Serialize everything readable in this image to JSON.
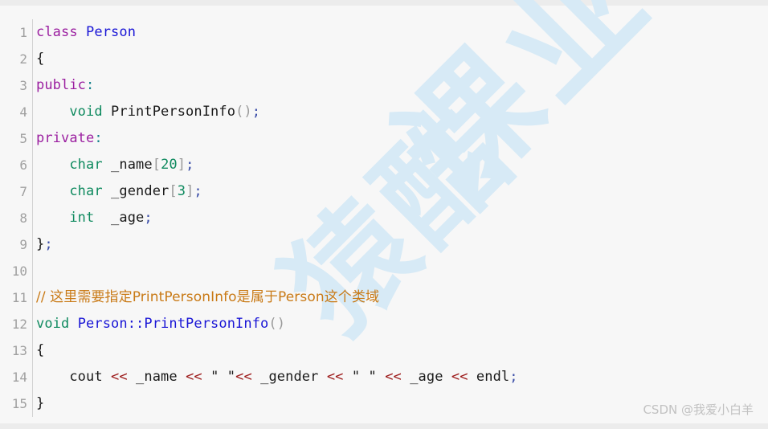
{
  "editor": {
    "language": "cpp",
    "background_color": "#f7f7f7",
    "gutter_color": "#a0a0a0",
    "divider_color": "#d2d2d2",
    "first_line": 1,
    "last_line": 15,
    "line_numbers": [
      "1",
      "2",
      "3",
      "4",
      "5",
      "6",
      "7",
      "8",
      "9",
      "10",
      "11",
      "12",
      "13",
      "14",
      "15"
    ],
    "lines": [
      {
        "number": "1",
        "tokens": [
          {
            "text": "class",
            "kind": "keyword"
          },
          {
            "text": " ",
            "kind": "plain"
          },
          {
            "text": "Person",
            "kind": "class"
          }
        ]
      },
      {
        "number": "2",
        "tokens": [
          {
            "text": "{",
            "kind": "plain"
          }
        ]
      },
      {
        "number": "3",
        "tokens": [
          {
            "text": "public",
            "kind": "keyword"
          },
          {
            "text": ":",
            "kind": "colon"
          }
        ]
      },
      {
        "number": "4",
        "tokens": [
          {
            "text": "    ",
            "kind": "plain"
          },
          {
            "text": "void",
            "kind": "type"
          },
          {
            "text": " ",
            "kind": "plain"
          },
          {
            "text": "PrintPersonInfo",
            "kind": "plain"
          },
          {
            "text": "(",
            "kind": "punct"
          },
          {
            "text": ")",
            "kind": "punct"
          },
          {
            "text": ";",
            "kind": "semi"
          }
        ]
      },
      {
        "number": "5",
        "tokens": [
          {
            "text": "private",
            "kind": "keyword"
          },
          {
            "text": ":",
            "kind": "colon"
          }
        ]
      },
      {
        "number": "6",
        "tokens": [
          {
            "text": "    ",
            "kind": "plain"
          },
          {
            "text": "char",
            "kind": "type"
          },
          {
            "text": " ",
            "kind": "plain"
          },
          {
            "text": "_name",
            "kind": "plain"
          },
          {
            "text": "[",
            "kind": "punct"
          },
          {
            "text": "20",
            "kind": "number"
          },
          {
            "text": "]",
            "kind": "punct"
          },
          {
            "text": ";",
            "kind": "semi"
          }
        ]
      },
      {
        "number": "7",
        "tokens": [
          {
            "text": "    ",
            "kind": "plain"
          },
          {
            "text": "char",
            "kind": "type"
          },
          {
            "text": " ",
            "kind": "plain"
          },
          {
            "text": "_gender",
            "kind": "plain"
          },
          {
            "text": "[",
            "kind": "punct"
          },
          {
            "text": "3",
            "kind": "number"
          },
          {
            "text": "]",
            "kind": "punct"
          },
          {
            "text": ";",
            "kind": "semi"
          }
        ]
      },
      {
        "number": "8",
        "tokens": [
          {
            "text": "    ",
            "kind": "plain"
          },
          {
            "text": "int",
            "kind": "type"
          },
          {
            "text": "  ",
            "kind": "plain"
          },
          {
            "text": "_age",
            "kind": "plain"
          },
          {
            "text": ";",
            "kind": "semi"
          }
        ]
      },
      {
        "number": "9",
        "tokens": [
          {
            "text": "}",
            "kind": "plain"
          },
          {
            "text": ";",
            "kind": "semi"
          }
        ]
      },
      {
        "number": "10",
        "tokens": []
      },
      {
        "number": "11",
        "tokens": [
          {
            "text": "// 这里需要指定PrintPersonInfo是属于Person这个类域",
            "kind": "comment-cjk"
          }
        ]
      },
      {
        "number": "12",
        "tokens": [
          {
            "text": "void",
            "kind": "type"
          },
          {
            "text": " ",
            "kind": "plain"
          },
          {
            "text": "Person::PrintPersonInfo",
            "kind": "class"
          },
          {
            "text": "(",
            "kind": "punct"
          },
          {
            "text": ")",
            "kind": "punct"
          }
        ]
      },
      {
        "number": "13",
        "tokens": [
          {
            "text": "{",
            "kind": "plain"
          }
        ]
      },
      {
        "number": "14",
        "tokens": [
          {
            "text": "    ",
            "kind": "plain"
          },
          {
            "text": "cout",
            "kind": "plain"
          },
          {
            "text": " ",
            "kind": "plain"
          },
          {
            "text": "<<",
            "kind": "operator"
          },
          {
            "text": " ",
            "kind": "plain"
          },
          {
            "text": "_name",
            "kind": "plain"
          },
          {
            "text": " ",
            "kind": "plain"
          },
          {
            "text": "<<",
            "kind": "operator"
          },
          {
            "text": " ",
            "kind": "plain"
          },
          {
            "text": "\" \"",
            "kind": "string"
          },
          {
            "text": "<<",
            "kind": "operator"
          },
          {
            "text": " ",
            "kind": "plain"
          },
          {
            "text": "_gender",
            "kind": "plain"
          },
          {
            "text": " ",
            "kind": "plain"
          },
          {
            "text": "<<",
            "kind": "operator"
          },
          {
            "text": " ",
            "kind": "plain"
          },
          {
            "text": "\" \"",
            "kind": "string"
          },
          {
            "text": " ",
            "kind": "plain"
          },
          {
            "text": "<<",
            "kind": "operator"
          },
          {
            "text": " ",
            "kind": "plain"
          },
          {
            "text": "_age",
            "kind": "plain"
          },
          {
            "text": " ",
            "kind": "plain"
          },
          {
            "text": "<<",
            "kind": "operator"
          },
          {
            "text": " ",
            "kind": "plain"
          },
          {
            "text": "endl",
            "kind": "plain"
          },
          {
            "text": ";",
            "kind": "semi"
          }
        ]
      },
      {
        "number": "15",
        "tokens": [
          {
            "text": "}",
            "kind": "plain"
          }
        ]
      }
    ]
  },
  "watermarks": {
    "diagonal_text_primary": "课业",
    "diagonal_text_secondary": "猿酷",
    "diagonal_color": "#d7eaf6",
    "credit": "CSDN @我爱小白羊",
    "credit_color": "#c2c2c2"
  },
  "theme": {
    "keyword_color": "#9b1fa0",
    "type_color": "#0f8a5f",
    "class_color": "#1a16d6",
    "comment_color": "#c97a16",
    "operator_color": "#9b1717",
    "number_color": "#0f8a5f",
    "punct_color": "#9a9a9a",
    "text_color": "#1a1a1a"
  }
}
